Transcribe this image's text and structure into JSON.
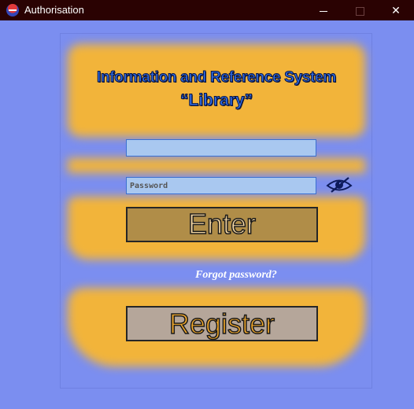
{
  "window": {
    "title": "Authorisation",
    "minimize_glyph": "",
    "close_glyph": "✕"
  },
  "header": {
    "line1": "Information and Reference System",
    "line2": "“Library”"
  },
  "login": {
    "value": "",
    "placeholder": ""
  },
  "password": {
    "value": "",
    "placeholder": "Password"
  },
  "buttons": {
    "enter": "Enter",
    "forgot": "Forgot password?",
    "register": "Register"
  },
  "icons": {
    "app": "app-logo-icon",
    "password_toggle": "eye-slash-icon"
  },
  "colors": {
    "background": "#7b8ef0",
    "titlebar": "#2a0202",
    "panel": "#f2b43a",
    "heading": "#2f6de8",
    "input": "#a9c8f0",
    "enter_button": "#b08d48",
    "register_button": "#b5a69a"
  }
}
